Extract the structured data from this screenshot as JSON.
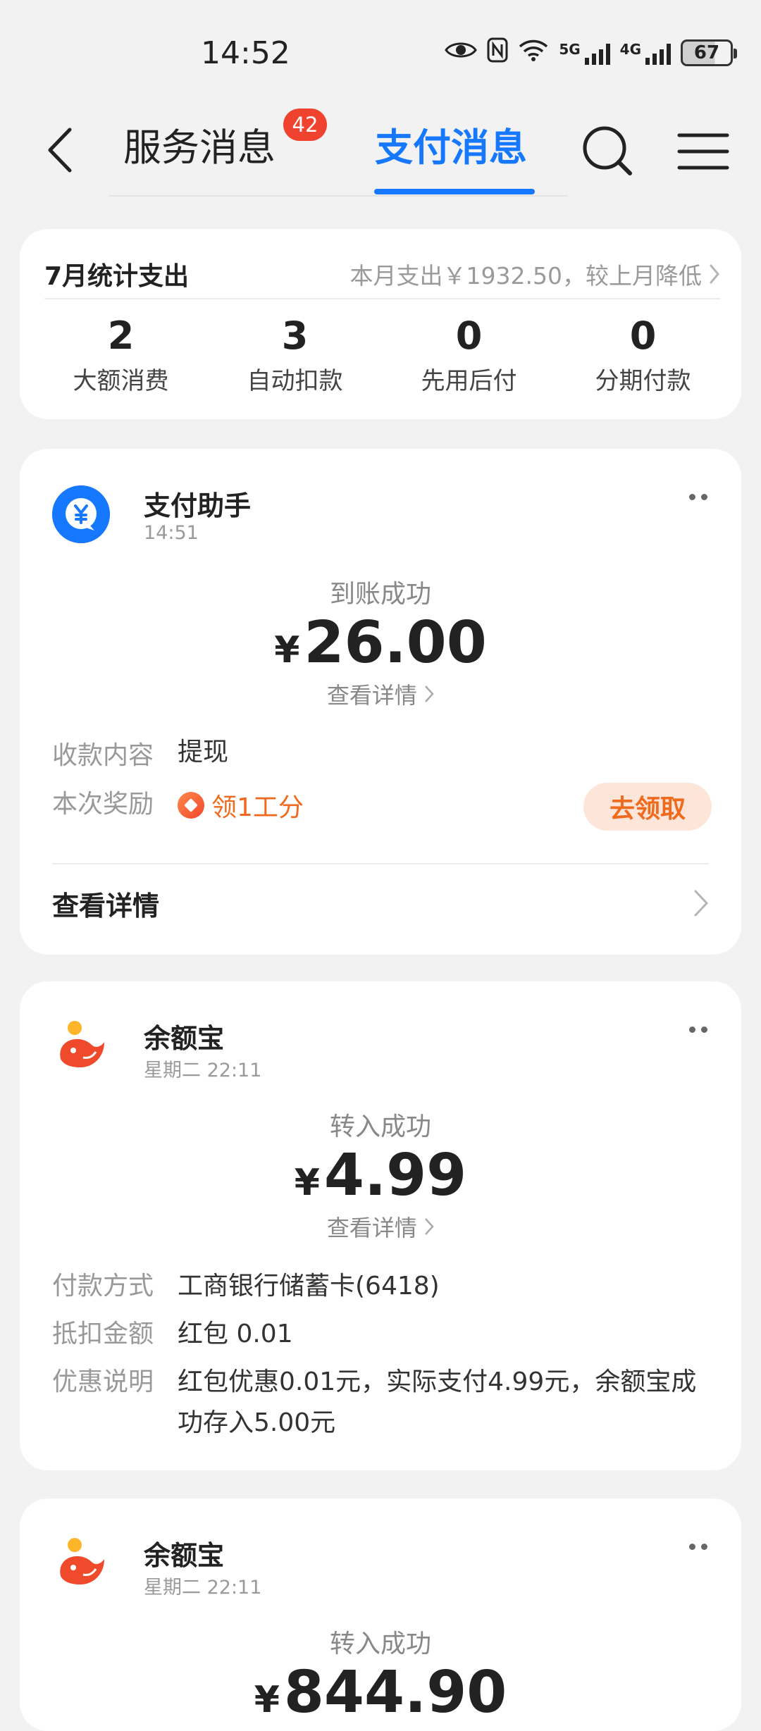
{
  "status_bar": {
    "time": "14:52",
    "signal_1": "5G",
    "signal_2": "4G",
    "battery": "67"
  },
  "nav": {
    "back_icon": "chevron-left-icon",
    "tabs": [
      {
        "label": "服务消息",
        "badge": "42",
        "active": false
      },
      {
        "label": "支付消息",
        "active": true
      }
    ],
    "search_icon": "search-icon",
    "menu_icon": "menu-icon",
    "accent_color": "#1677ff"
  },
  "summary": {
    "title": "7月统计支出",
    "note": "本月支出￥1932.50，较上月降低",
    "stats": [
      {
        "value": "2",
        "label": "大额消费"
      },
      {
        "value": "3",
        "label": "自动扣款"
      },
      {
        "value": "0",
        "label": "先用后付"
      },
      {
        "value": "0",
        "label": "分期付款"
      }
    ]
  },
  "messages": [
    {
      "sender": "支付助手",
      "time": "14:51",
      "status": "到账成功",
      "currency": "¥",
      "amount": "26.00",
      "detail_link": "查看详情",
      "rows": [
        {
          "label": "收款内容",
          "value": "提现"
        },
        {
          "label": "本次奖励",
          "value": "领1工分"
        }
      ],
      "action": "去领取",
      "footer": "查看详情"
    },
    {
      "sender": "余额宝",
      "time": "星期二 22:11",
      "status": "转入成功",
      "currency": "¥",
      "amount": "4.99",
      "detail_link": "查看详情",
      "rows": [
        {
          "label": "付款方式",
          "value": "工商银行储蓄卡(6418)"
        },
        {
          "label": "抵扣金额",
          "value": "红包 0.01"
        },
        {
          "label": "优惠说明",
          "value": "红包优惠0.01元，实际支付4.99元，余额宝成功存入5.00元"
        }
      ]
    },
    {
      "sender": "余额宝",
      "time": "星期二 22:11",
      "status": "转入成功",
      "currency": "¥",
      "amount": "844.90"
    }
  ]
}
